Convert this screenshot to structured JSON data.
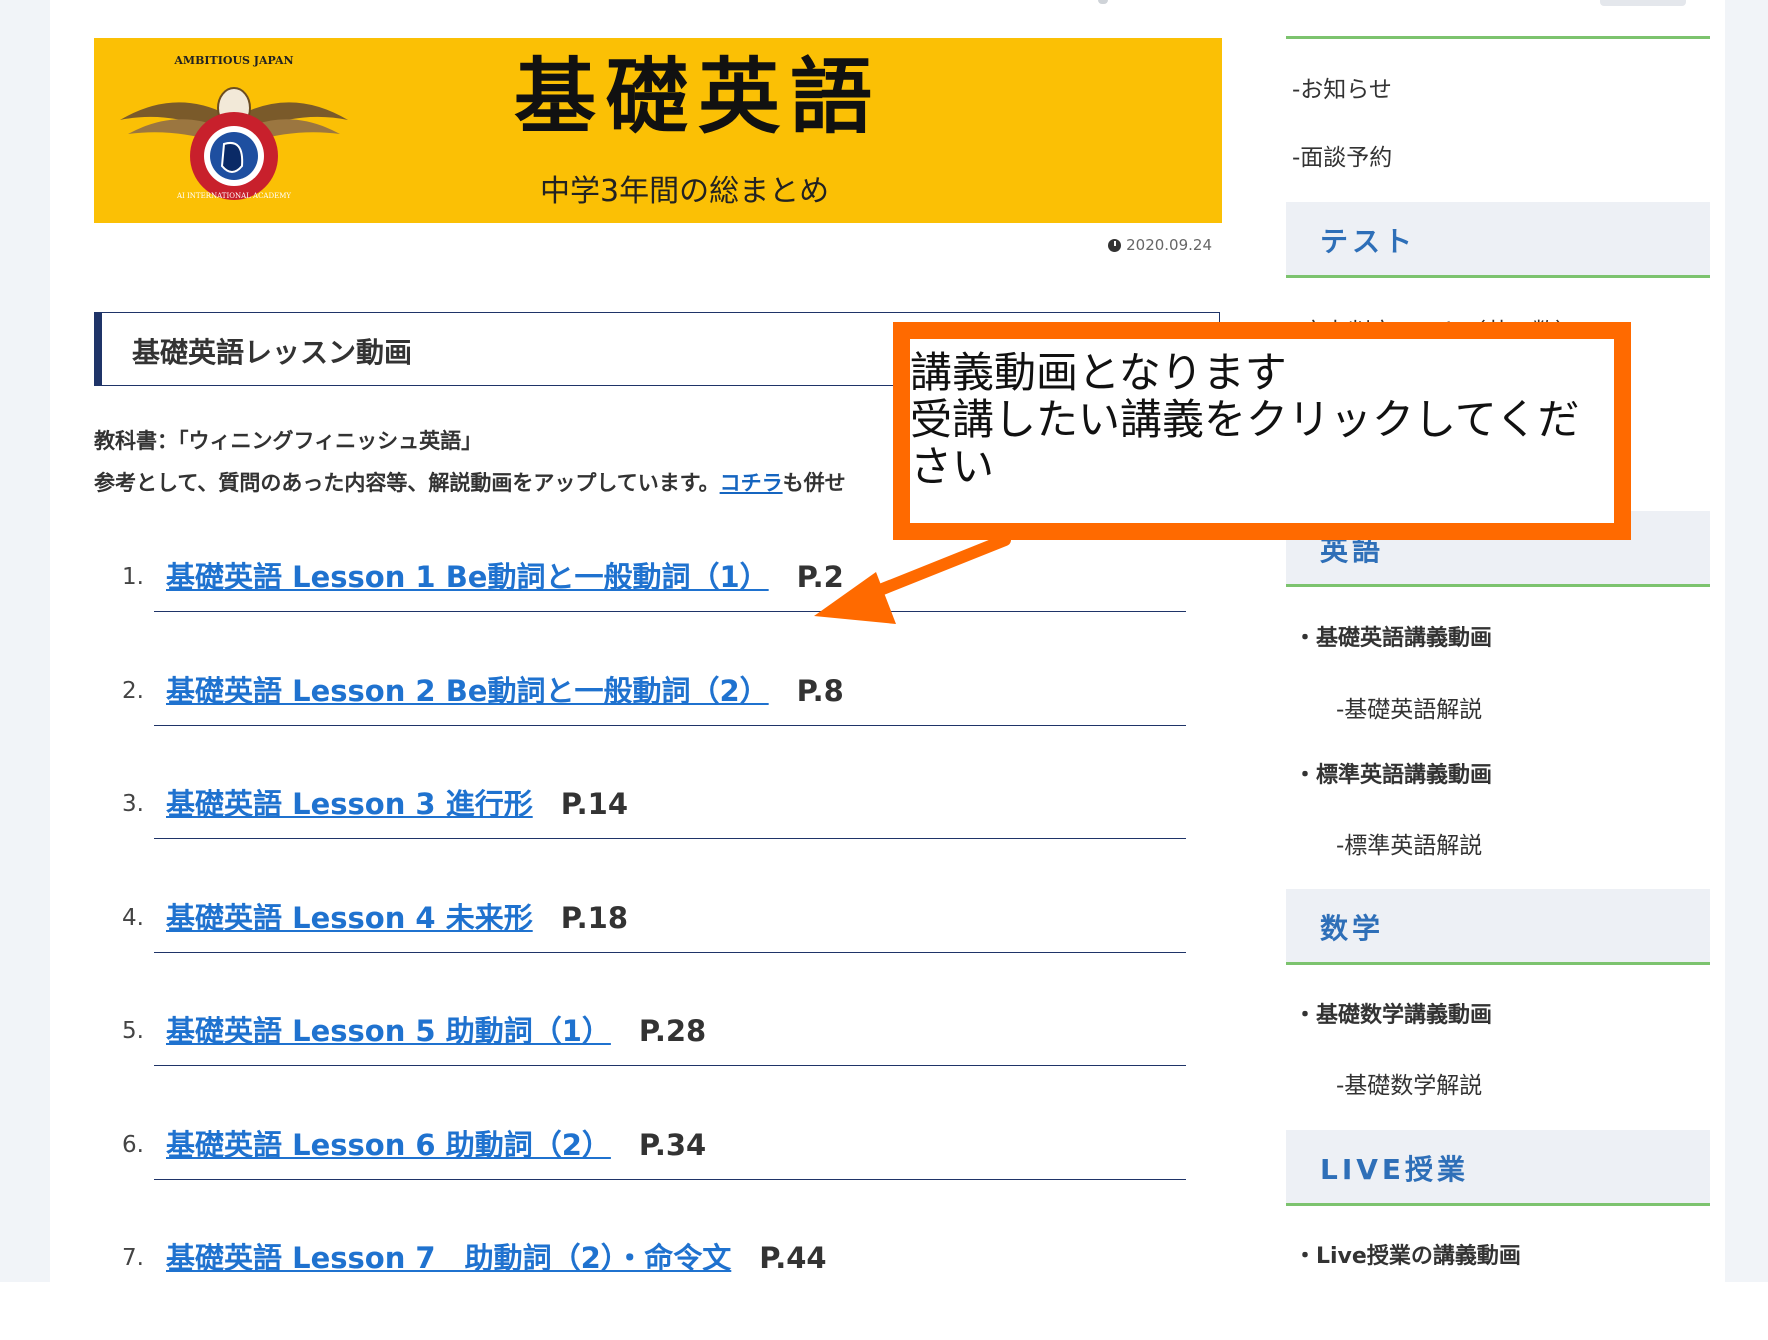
{
  "banner": {
    "emblem_top_text": "AMBITIOUS JAPAN",
    "emblem_ring_text": "AI INTERNATIONAL ACADEMY",
    "title": "基礎英語",
    "subtitle": "中学3年間の総まとめ"
  },
  "post_date": "2020.09.24",
  "section_heading": "基礎英語レッスン動画",
  "intro": {
    "textbook": "教科書：「ウィニングフィニッシュ英語」",
    "note_prefix": "参考として、質問のあった内容等、解説動画をアップしています。",
    "note_link": "コチラ",
    "note_suffix": "も併せ"
  },
  "lessons": [
    {
      "num": "1.",
      "title": "基礎英語 Lesson 1 Be動詞と一般動詞（1）",
      "page": "P.2"
    },
    {
      "num": "2.",
      "title": "基礎英語 Lesson 2 Be動詞と一般動詞（2）",
      "page": "P.8"
    },
    {
      "num": "3.",
      "title": "基礎英語 Lesson 3 進行形",
      "page": "P.14"
    },
    {
      "num": "4.",
      "title": "基礎英語 Lesson 4 未来形",
      "page": "P.18"
    },
    {
      "num": "5.",
      "title": "基礎英語 Lesson 5 助動詞（1）",
      "page": "P.28"
    },
    {
      "num": "6.",
      "title": "基礎英語 Lesson 6 助動詞（2）",
      "page": "P.34"
    },
    {
      "num": "7.",
      "title": "基礎英語 Lesson 7　助動詞（2）・命令文",
      "page": "P.44"
    }
  ],
  "sidebar": {
    "news": "-お知らせ",
    "interview": "-面談予約",
    "test_heading": "テスト",
    "test_link_partial": "実力判定テスト（英・数）",
    "english_heading": "英語",
    "english_items": [
      "・基礎英語講義動画",
      "-基礎英語解説",
      "・標準英語講義動画",
      "-標準英語解説"
    ],
    "math_heading": "数学",
    "math_items": [
      "・基礎数学講義動画",
      "-基礎数学解説"
    ],
    "live_heading": "LIVE授業",
    "live_items": [
      "・Live授業の講義動画"
    ]
  },
  "callout": {
    "text": "講義動画となります\n受講したい講義をクリックしてください"
  },
  "colors": {
    "banner": "#fbc005",
    "link": "#1f72cf",
    "navy": "#1f3468",
    "accent_green": "#7cc36e",
    "callout_orange": "#ff6a00",
    "sidebar_heading": "#2e6fb8"
  }
}
